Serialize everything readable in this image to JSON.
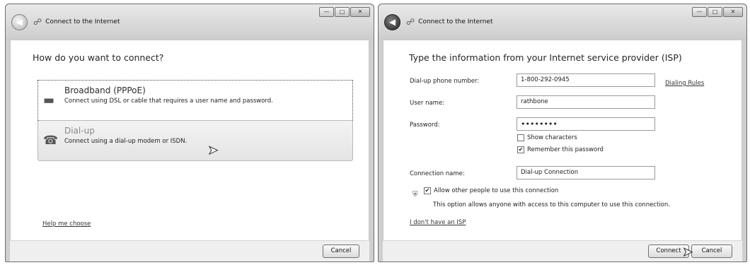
{
  "left_window": {
    "title": "Connect to the Internet",
    "heading": "How do you want to connect?",
    "options": [
      {
        "title": "Broadband (PPPoE)",
        "description": "Connect using DSL or cable that requires a user name and password.",
        "icon": "broadband-modem-icon"
      },
      {
        "title": "Dial-up",
        "description": "Connect using a dial-up modem or ISDN.",
        "icon": "dialup-modem-icon"
      }
    ],
    "help_link": "Help me choose",
    "cancel_label": "Cancel"
  },
  "right_window": {
    "title": "Connect to the Internet",
    "heading": "Type the information from your Internet service provider (ISP)",
    "fields": {
      "phone_label": "Dial-up phone number:",
      "phone_value": "1-800-292-0945",
      "dialing_rules": "Dialing Rules",
      "user_label": "User name:",
      "user_value": "rathbone",
      "password_label": "Password:",
      "password_value": "••••••••",
      "show_characters": "Show characters",
      "remember_password": "Remember this password",
      "connection_name_label": "Connection name:",
      "connection_name_value": "Dial-up Connection"
    },
    "allow_others": "Allow other people to use this connection",
    "allow_note": "This option allows anyone with access to this computer to use this connection.",
    "no_isp_link": "I don't have an ISP",
    "connect_label": "Connect",
    "cancel_label": "Cancel",
    "checks": {
      "show_characters": false,
      "remember_password": true,
      "allow_others": true
    }
  }
}
